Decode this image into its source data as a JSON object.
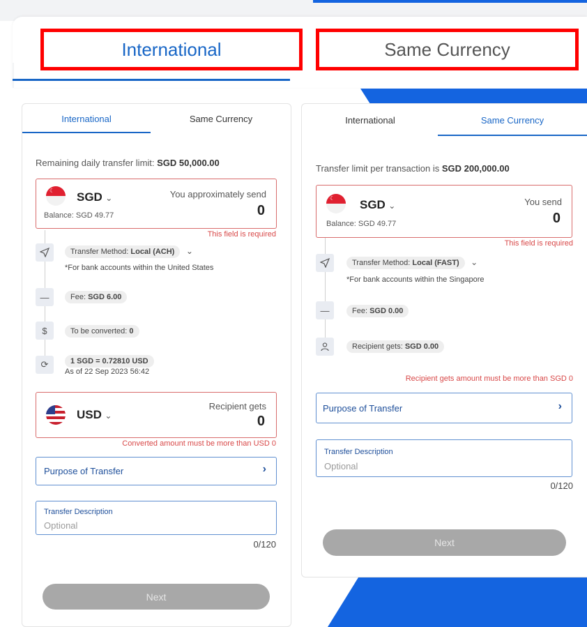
{
  "top_tabs": {
    "international": "International",
    "same_currency": "Same Currency"
  },
  "left": {
    "tabs": {
      "international": "International",
      "same_currency": "Same Currency"
    },
    "limit_text": "Remaining daily transfer limit: ",
    "limit_value": "SGD 50,000.00",
    "send": {
      "currency": "SGD",
      "label": "You approximately send",
      "amount": "0",
      "balance": "Balance: SGD 49.77",
      "error": "This field is required"
    },
    "transfer_method_prefix": "Transfer Method: ",
    "transfer_method_value": "Local (ACH)",
    "transfer_method_note": "*For bank accounts within the United States",
    "fee_prefix": "Fee: ",
    "fee_value": "SGD 6.00",
    "converted_prefix": "To be converted: ",
    "converted_value": "0",
    "rate_value": "1 SGD = 0.72810 USD",
    "rate_date": "As of 22 Sep 2023 56:42",
    "receive": {
      "currency": "USD",
      "label": "Recipient gets",
      "amount": "0",
      "error": "Converted amount must be more than USD 0"
    },
    "purpose": "Purpose of Transfer",
    "desc_label": "Transfer Description",
    "desc_placeholder": "Optional",
    "counter": "0/120",
    "next": "Next"
  },
  "right": {
    "tabs": {
      "international": "International",
      "same_currency": "Same Currency"
    },
    "limit_text": "Transfer limit per transaction is ",
    "limit_value": "SGD 200,000.00",
    "send": {
      "currency": "SGD",
      "label": "You send",
      "amount": "0",
      "balance": "Balance: SGD 49.77",
      "error": "This field is required"
    },
    "transfer_method_prefix": "Transfer Method: ",
    "transfer_method_value": "Local (FAST)",
    "transfer_method_note": "*For bank accounts within the Singapore",
    "fee_prefix": "Fee: ",
    "fee_value": "SGD 0.00",
    "recipient_prefix": "Recipient gets: ",
    "recipient_value": "SGD 0.00",
    "recipient_error": "Recipient gets amount must be more than SGD 0",
    "purpose": "Purpose of Transfer",
    "desc_label": "Transfer Description",
    "desc_placeholder": "Optional",
    "counter": "0/120",
    "next": "Next"
  },
  "icons": {
    "chevron_down": "⌄",
    "chevron_right": "›",
    "send": "send-icon",
    "fee": "minus-icon",
    "convert": "dollar-icon",
    "rate": "refresh-icon",
    "recipient": "person-icon"
  },
  "colors": {
    "accent": "#1866c6",
    "highlight_box": "#ff0000",
    "brand_blue": "#1464e0",
    "error": "#d84848"
  }
}
